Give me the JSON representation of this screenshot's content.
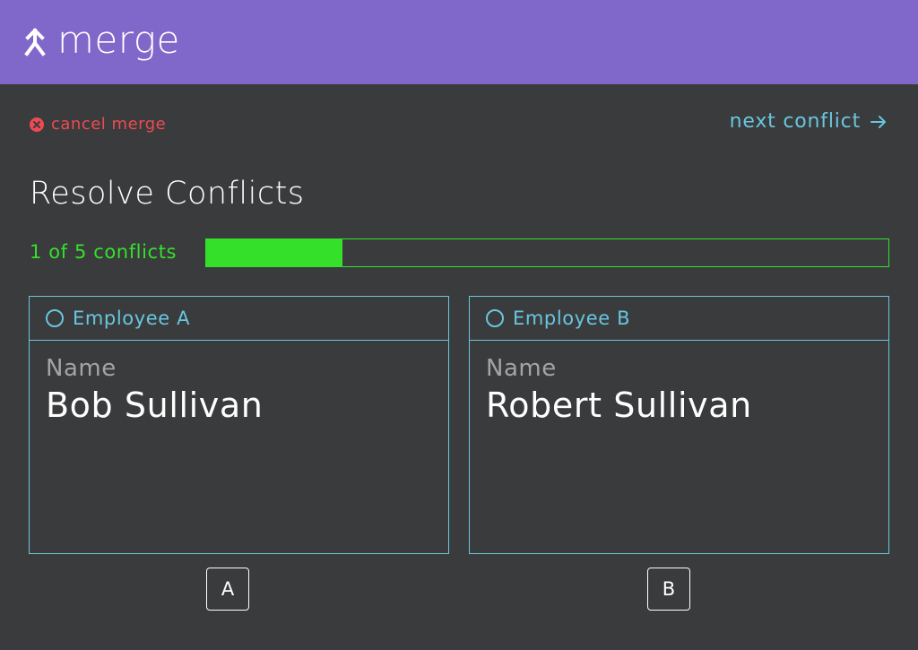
{
  "header": {
    "logo_icon": "merge-arrow-icon",
    "app_name": "merge"
  },
  "actions": {
    "cancel_label": "cancel merge",
    "cancel_icon": "close-circle-icon",
    "next_label": "next conflict",
    "next_icon": "arrow-right-icon"
  },
  "page": {
    "title": "Resolve Conflicts"
  },
  "progress": {
    "label": "1 of 5 conflicts",
    "current": 1,
    "total": 5
  },
  "options": [
    {
      "label": "Employee A",
      "field_label": "Name",
      "field_value": "Bob Sullivan",
      "button_label": "A"
    },
    {
      "label": "Employee B",
      "field_label": "Name",
      "field_value": "Robert Sullivan",
      "button_label": "B"
    }
  ],
  "colors": {
    "header_bg": "#8067ca",
    "page_bg": "#3a3b3c",
    "accent": "#69c6e0",
    "danger": "#ef4a53",
    "progress": "#35e02b"
  }
}
